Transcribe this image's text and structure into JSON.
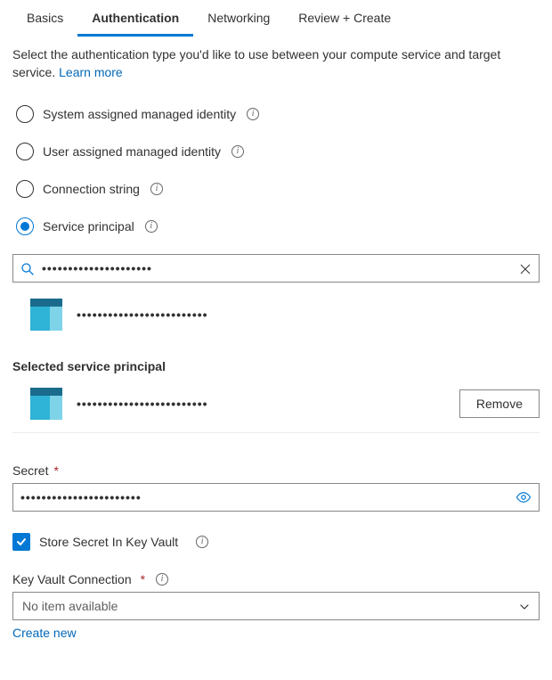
{
  "tabs": {
    "items": [
      {
        "label": "Basics",
        "selected": false
      },
      {
        "label": "Authentication",
        "selected": true
      },
      {
        "label": "Networking",
        "selected": false
      },
      {
        "label": "Review + Create",
        "selected": false
      }
    ]
  },
  "intro": {
    "text": "Select the authentication type you'd like to use between your compute service and target service. ",
    "link": "Learn more"
  },
  "radio": {
    "items": [
      {
        "label": "System assigned managed identity",
        "selected": false
      },
      {
        "label": "User assigned managed identity",
        "selected": false
      },
      {
        "label": "Connection string",
        "selected": false
      },
      {
        "label": "Service principal",
        "selected": true
      }
    ]
  },
  "search": {
    "value": "•••••••••••••••••••••"
  },
  "dropdown_result": {
    "label": "•••••••••••••••••••••••••"
  },
  "selected_principal": {
    "heading": "Selected service principal",
    "label": "•••••••••••••••••••••••••",
    "remove": "Remove"
  },
  "secret": {
    "label": "Secret",
    "value": "•••••••••••••••••••••••"
  },
  "store_kv": {
    "checked": true,
    "label": "Store Secret In Key Vault"
  },
  "kv_connection": {
    "label": "Key Vault Connection",
    "value": "No item available",
    "create_new": "Create new"
  }
}
